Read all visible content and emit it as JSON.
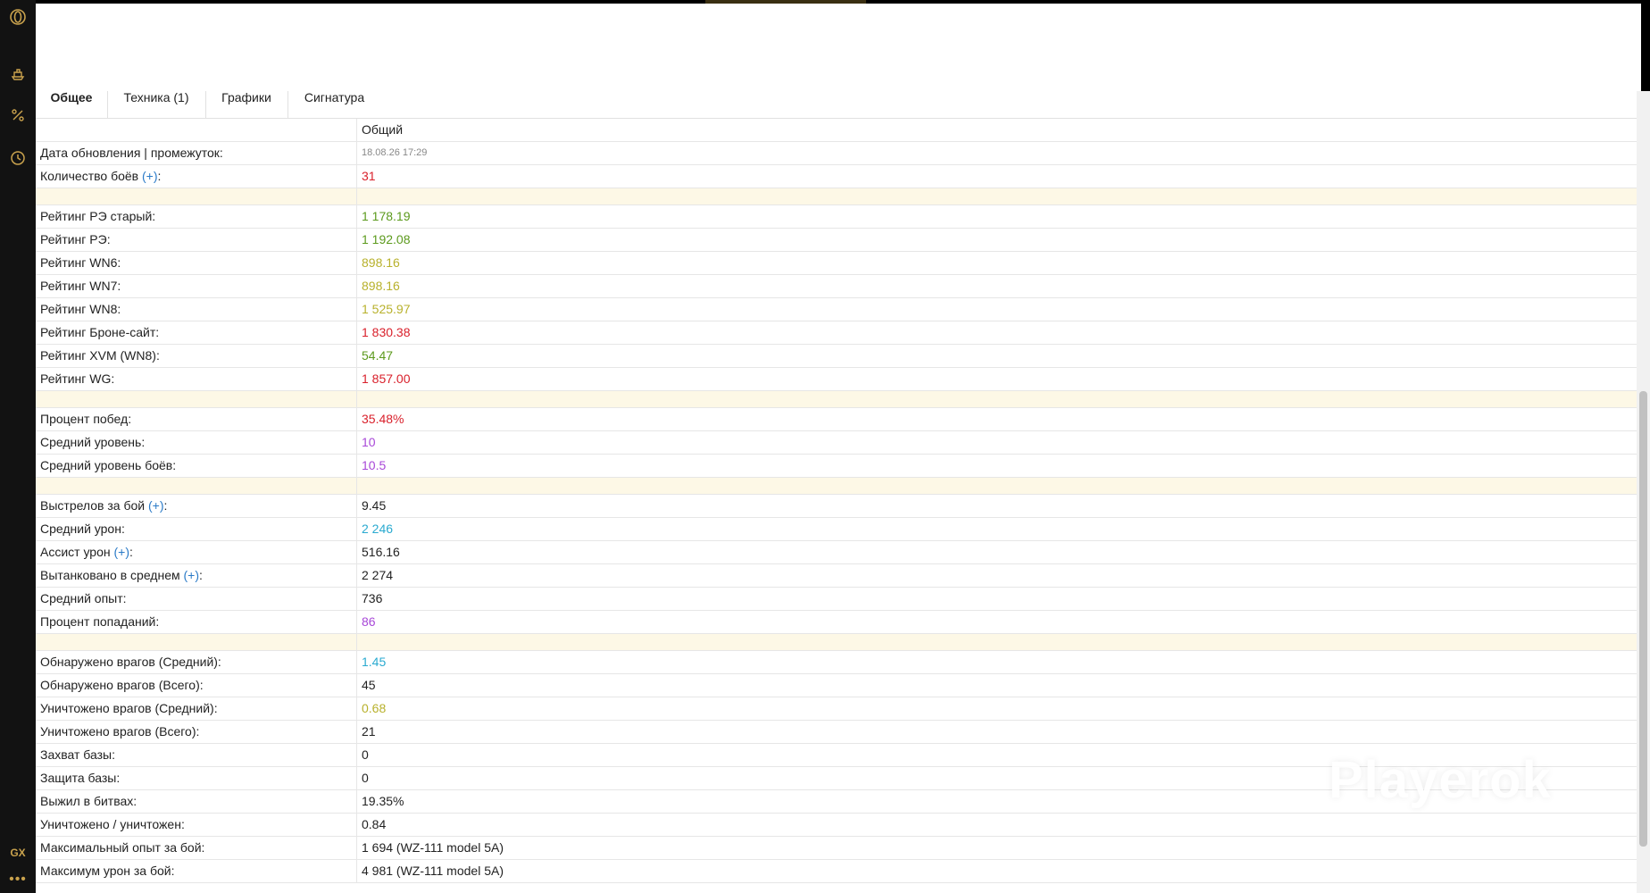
{
  "sidebar": {
    "icons": [
      "opera-logo-icon",
      "ship-icon",
      "percent-icon",
      "clock-icon",
      "gx-icon",
      "more-icon"
    ],
    "gx_label": "GX",
    "more_label": "•••"
  },
  "tabs": [
    {
      "label": "Общее",
      "active": true
    },
    {
      "label": "Техника (1)",
      "active": false
    },
    {
      "label": "Графики",
      "active": false
    },
    {
      "label": "Сигнатура",
      "active": false
    }
  ],
  "table": {
    "column_header": "Общий",
    "update_label": "Дата обновления | промежуток:",
    "update_value": "18.08.26 17:29",
    "battles_label": "Количество боёв",
    "battles_plus": "(+)",
    "battles_value": "31",
    "ratings": [
      {
        "label": "Рейтинг РЭ старый:",
        "value": "1 178.19",
        "color": "#5c9a1d"
      },
      {
        "label": "Рейтинг РЭ:",
        "value": "1 192.08",
        "color": "#5c9a1d"
      },
      {
        "label": "Рейтинг WN6:",
        "value": "898.16",
        "color": "#b8b12c"
      },
      {
        "label": "Рейтинг WN7:",
        "value": "898.16",
        "color": "#b8b12c"
      },
      {
        "label": "Рейтинг WN8:",
        "value": "1 525.97",
        "color": "#b8b12c"
      },
      {
        "label": "Рейтинг Броне-сайт:",
        "value": "1 830.38",
        "color": "#d9202b"
      },
      {
        "label": "Рейтинг XVM (WN8):",
        "value": "54.47",
        "color": "#5c9a1d"
      },
      {
        "label": "Рейтинг WG:",
        "value": "1 857.00",
        "color": "#d9202b"
      }
    ],
    "wins_label": "Процент побед:",
    "wins_value": "35.48%",
    "avg_level_label": "Средний уровень:",
    "avg_level_value": "10",
    "avg_battle_level_label": "Средний уровень боёв:",
    "avg_battle_level_value": "10.5",
    "shots_label": "Выстрелов за бой",
    "shots_plus": "(+)",
    "shots_value": "9.45",
    "avg_damage_label": "Средний урон:",
    "avg_damage_value": "2 246",
    "assist_label": "Ассист урон",
    "assist_plus": "(+)",
    "assist_value": "516.16",
    "tanked_label": "Вытанковано в среднем",
    "tanked_plus": "(+)",
    "tanked_value": "2 274",
    "avg_xp_label": "Средний опыт:",
    "avg_xp_value": "736",
    "hit_label": "Процент попаданий:",
    "hit_value": "86",
    "spotted_avg_label": "Обнаружено врагов (Средний):",
    "spotted_avg_value": "1.45",
    "spotted_total_label": "Обнаружено врагов (Всего):",
    "spotted_total_value": "45",
    "killed_avg_label": "Уничтожено врагов (Средний):",
    "killed_avg_value": "0.68",
    "killed_total_label": "Уничтожено врагов (Всего):",
    "killed_total_value": "21",
    "capture_label": "Захват базы:",
    "capture_value": "0",
    "defense_label": "Защита базы:",
    "defense_value": "0",
    "survived_label": "Выжил в битвах:",
    "survived_value": "19.35%",
    "kd_label": "Уничтожено / уничтожен:",
    "kd_value": "0.84",
    "max_xp_label": "Максимальный опыт за бой:",
    "max_xp_value": "1 694 (WZ-111 model 5A)",
    "max_damage_label": "Максимум урон за бой:",
    "max_damage_value": "4 981 (WZ-111 model 5A)"
  },
  "watermark": "Playerok"
}
